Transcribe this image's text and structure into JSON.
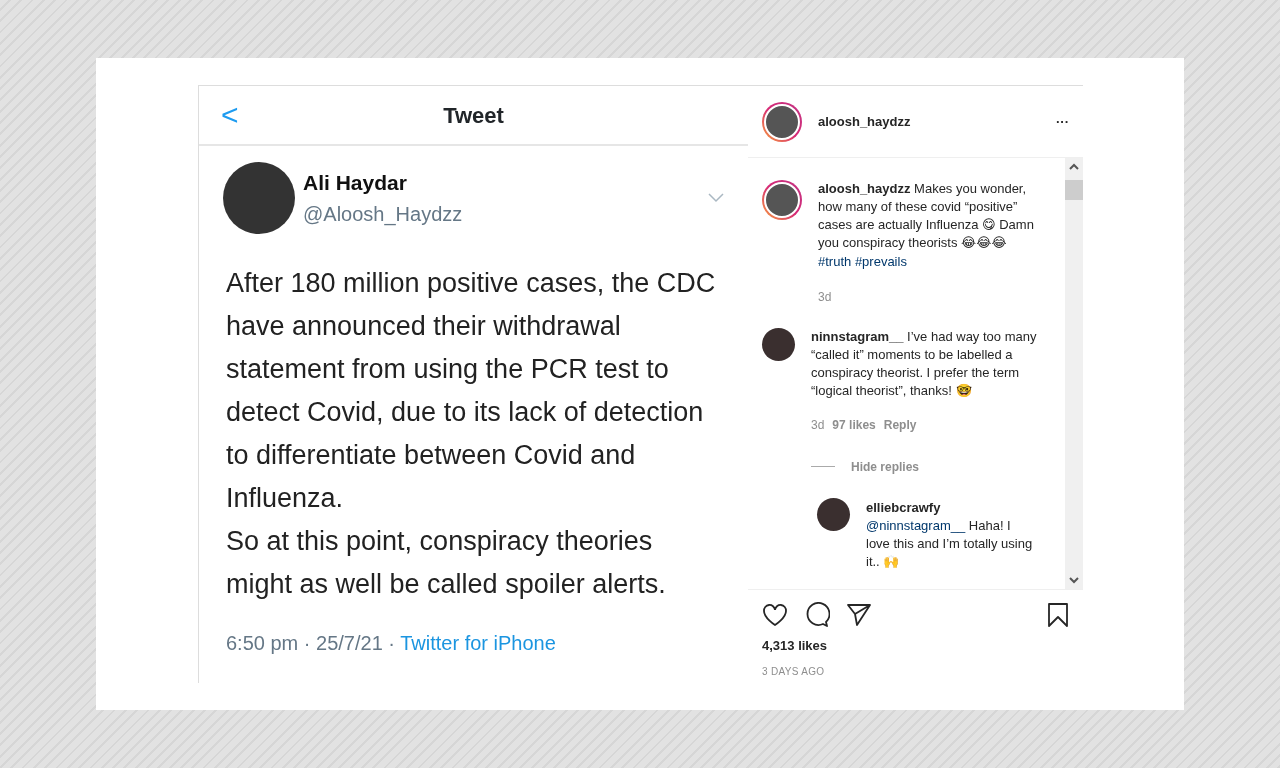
{
  "tweet": {
    "back": "<",
    "title": "Tweet",
    "author": {
      "name": "Ali Haydar",
      "handle": "@Aloosh_Haydzz"
    },
    "paragraphs": [
      "After 180 million positive cases, the CDC have announced their withdrawal statement from using the PCR test to detect Covid, due to its lack of detection to differentiate between Covid and Influenza.",
      "So at this point, conspiracy theories might as well be called spoiler alerts."
    ],
    "meta": "6:50 pm · 25/7/21 · ",
    "source": "Twitter for iPhone"
  },
  "post": {
    "username": "aloosh_haydzz",
    "more": "···",
    "caption": {
      "text": "**aloosh_haydzz** Makes you wonder, how many of these covid “positive” cases are actually Influenza 😋 Damn you conspiracy theorists 😂😂😂",
      "hashtags": [
        "#truth",
        "#prevails"
      ],
      "time": "3d"
    },
    "comments": [
      {
        "text": "**ninnstagram__** I’ve had way too many “called it” moments to be labelled a conspiracy theorist. I prefer the term “logical theorist”, thanks! 🤓",
        "time": "3d",
        "likes": "97 likes",
        "reply": "Reply",
        "toggle": "Hide replies",
        "replies": [
          {
            "username": "elliebcrawfy",
            "mention": "@ninnstagram__",
            "text": " Haha! I love this and I’m totally using it.. 🙌"
          }
        ]
      }
    ],
    "likes": "4,313 likes",
    "date": "3 DAYS AGO"
  }
}
